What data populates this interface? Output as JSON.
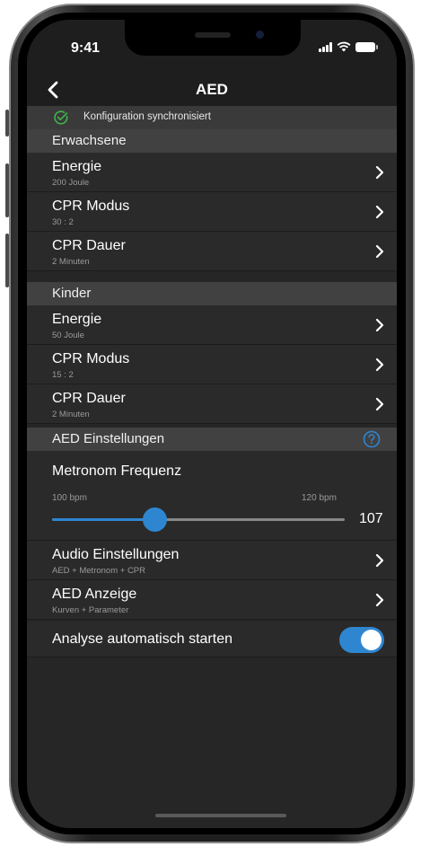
{
  "status_bar": {
    "time": "9:41"
  },
  "nav": {
    "title": "AED"
  },
  "sync": {
    "text": "Konfiguration synchronisiert"
  },
  "adults": {
    "header": "Erwachsene",
    "rows": [
      {
        "title": "Energie",
        "subtitle": "200 Joule"
      },
      {
        "title": "CPR Modus",
        "subtitle": "30 : 2"
      },
      {
        "title": "CPR Dauer",
        "subtitle": "2 Minuten"
      }
    ]
  },
  "children": {
    "header": "Kinder",
    "rows": [
      {
        "title": "Energie",
        "subtitle": "50 Joule"
      },
      {
        "title": "CPR Modus",
        "subtitle": "15 : 2"
      },
      {
        "title": "CPR Dauer",
        "subtitle": "2 Minuten"
      }
    ]
  },
  "aed_settings": {
    "header": "AED Einstellungen",
    "metronome": {
      "title": "Metronom Frequenz",
      "min_label": "100 bpm",
      "max_label": "120 bpm",
      "min": 100,
      "max": 120,
      "value": 107,
      "value_label": "107"
    },
    "rows": [
      {
        "title": "Audio Einstellungen",
        "subtitle": "AED + Metronom + CPR"
      },
      {
        "title": "AED Anzeige",
        "subtitle": "Kurven + Parameter"
      }
    ],
    "auto_analysis": {
      "label": "Analyse automatisch starten",
      "on": true
    }
  },
  "colors": {
    "accent": "#2f86d0",
    "success": "#3fb54a",
    "background": "#262626",
    "header": "#414141"
  }
}
